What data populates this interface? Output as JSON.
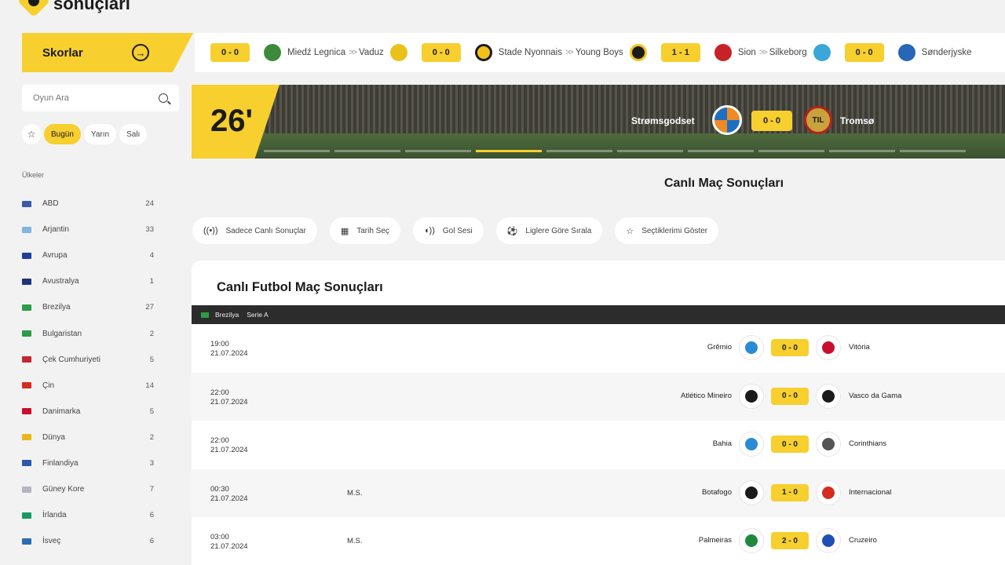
{
  "header": {
    "logo_text": "sonuçları"
  },
  "skorlar": {
    "label": "Skorlar",
    "arrow": "→"
  },
  "ticker": [
    {
      "score": "0 - 0",
      "home": "Miedź Legnica",
      "away": "Vaduz",
      "home_color": "#3d8a3a",
      "away_color": "#e8c21a"
    },
    {
      "score": "0 - 0",
      "home": "Stade Nyonnais",
      "away": "Young Boys",
      "home_color": "#f2c21b",
      "away_color": "#f2c21b"
    },
    {
      "score": "1 - 1",
      "home": "Sion",
      "away": "Silkeborg",
      "home_color": "#c72326",
      "away_color": "#3aa7d8"
    },
    {
      "score": "0 - 0",
      "home": "Sønderjyske",
      "away": "",
      "home_color": "#2767b5",
      "away_color": ""
    }
  ],
  "sidebar": {
    "search_placeholder": "Oyun Ara",
    "days": [
      "Bugün",
      "Yarın",
      "Salı"
    ],
    "star": "☆",
    "countries_heading": "Ülkeler",
    "countries": [
      {
        "name": "ABD",
        "count": "24",
        "color": "#3b5aa8"
      },
      {
        "name": "Arjantin",
        "count": "33",
        "color": "#7fb6e3"
      },
      {
        "name": "Avrupa",
        "count": "4",
        "color": "#1f3f9a"
      },
      {
        "name": "Avustralya",
        "count": "1",
        "color": "#1f3577"
      },
      {
        "name": "Brezilya",
        "count": "27",
        "color": "#2e9b45"
      },
      {
        "name": "Bulgaristan",
        "count": "2",
        "color": "#2e9b45"
      },
      {
        "name": "Çek Cumhuriyeti",
        "count": "5",
        "color": "#c2262e"
      },
      {
        "name": "Çin",
        "count": "14",
        "color": "#d62b1f"
      },
      {
        "name": "Danimarka",
        "count": "5",
        "color": "#c8102e"
      },
      {
        "name": "Dünya",
        "count": "2",
        "color": "#e8b71a"
      },
      {
        "name": "Finlandiya",
        "count": "3",
        "color": "#2b58a6"
      },
      {
        "name": "Güney Kore",
        "count": "7",
        "color": "#b5b5c2"
      },
      {
        "name": "İrlanda",
        "count": "6",
        "color": "#169b62"
      },
      {
        "name": "İsveç",
        "count": "6",
        "color": "#2b6cb5"
      }
    ]
  },
  "banner": {
    "minute": "26'",
    "home": "Strømsgodset",
    "away": "Tromsø",
    "away_logo_text": "TIL",
    "score": "0 - 0"
  },
  "main": {
    "page_title": "Canlı Maç Sonuçları",
    "filters": [
      {
        "label": "Sadece Canlı Sonuçlar",
        "icon": "((•))"
      },
      {
        "label": "Tarih Seç",
        "icon": "▦"
      },
      {
        "label": "Gol Sesi",
        "icon": "◖))"
      },
      {
        "label": "Liglere Göre Sırala",
        "icon": "⚽"
      },
      {
        "label": "Seçtiklerimi Göster",
        "icon": "☆"
      }
    ],
    "results_title": "Canlı Futbol Maç Sonuçları",
    "league": {
      "country": "Brezilya",
      "name": "Serie A"
    },
    "matches": [
      {
        "time": "19:00",
        "date": "21.07.2024",
        "status": "",
        "home": "Grêmio",
        "score": "0 - 0",
        "away": "Vitória",
        "home_color": "#2a8ad4",
        "away_color": "#c8102e"
      },
      {
        "time": "22:00",
        "date": "21.07.2024",
        "status": "",
        "home": "Atlético Mineiro",
        "score": "0 - 0",
        "away": "Vasco da Gama",
        "home_color": "#1b1b1b",
        "away_color": "#1b1b1b"
      },
      {
        "time": "22:00",
        "date": "21.07.2024",
        "status": "",
        "home": "Bahia",
        "score": "0 - 0",
        "away": "Corinthians",
        "home_color": "#2a8ad4",
        "away_color": "#555555"
      },
      {
        "time": "00:30",
        "date": "21.07.2024",
        "status": "M.S.",
        "home": "Botafogo",
        "score": "1 - 0",
        "away": "Internacional",
        "home_color": "#1b1b1b",
        "away_color": "#d62b1f"
      },
      {
        "time": "03:00",
        "date": "21.07.2024",
        "status": "M.S.",
        "home": "Palmeiras",
        "score": "2 - 0",
        "away": "Cruzeiro",
        "home_color": "#1f8a3c",
        "away_color": "#1f4fb5"
      }
    ]
  }
}
